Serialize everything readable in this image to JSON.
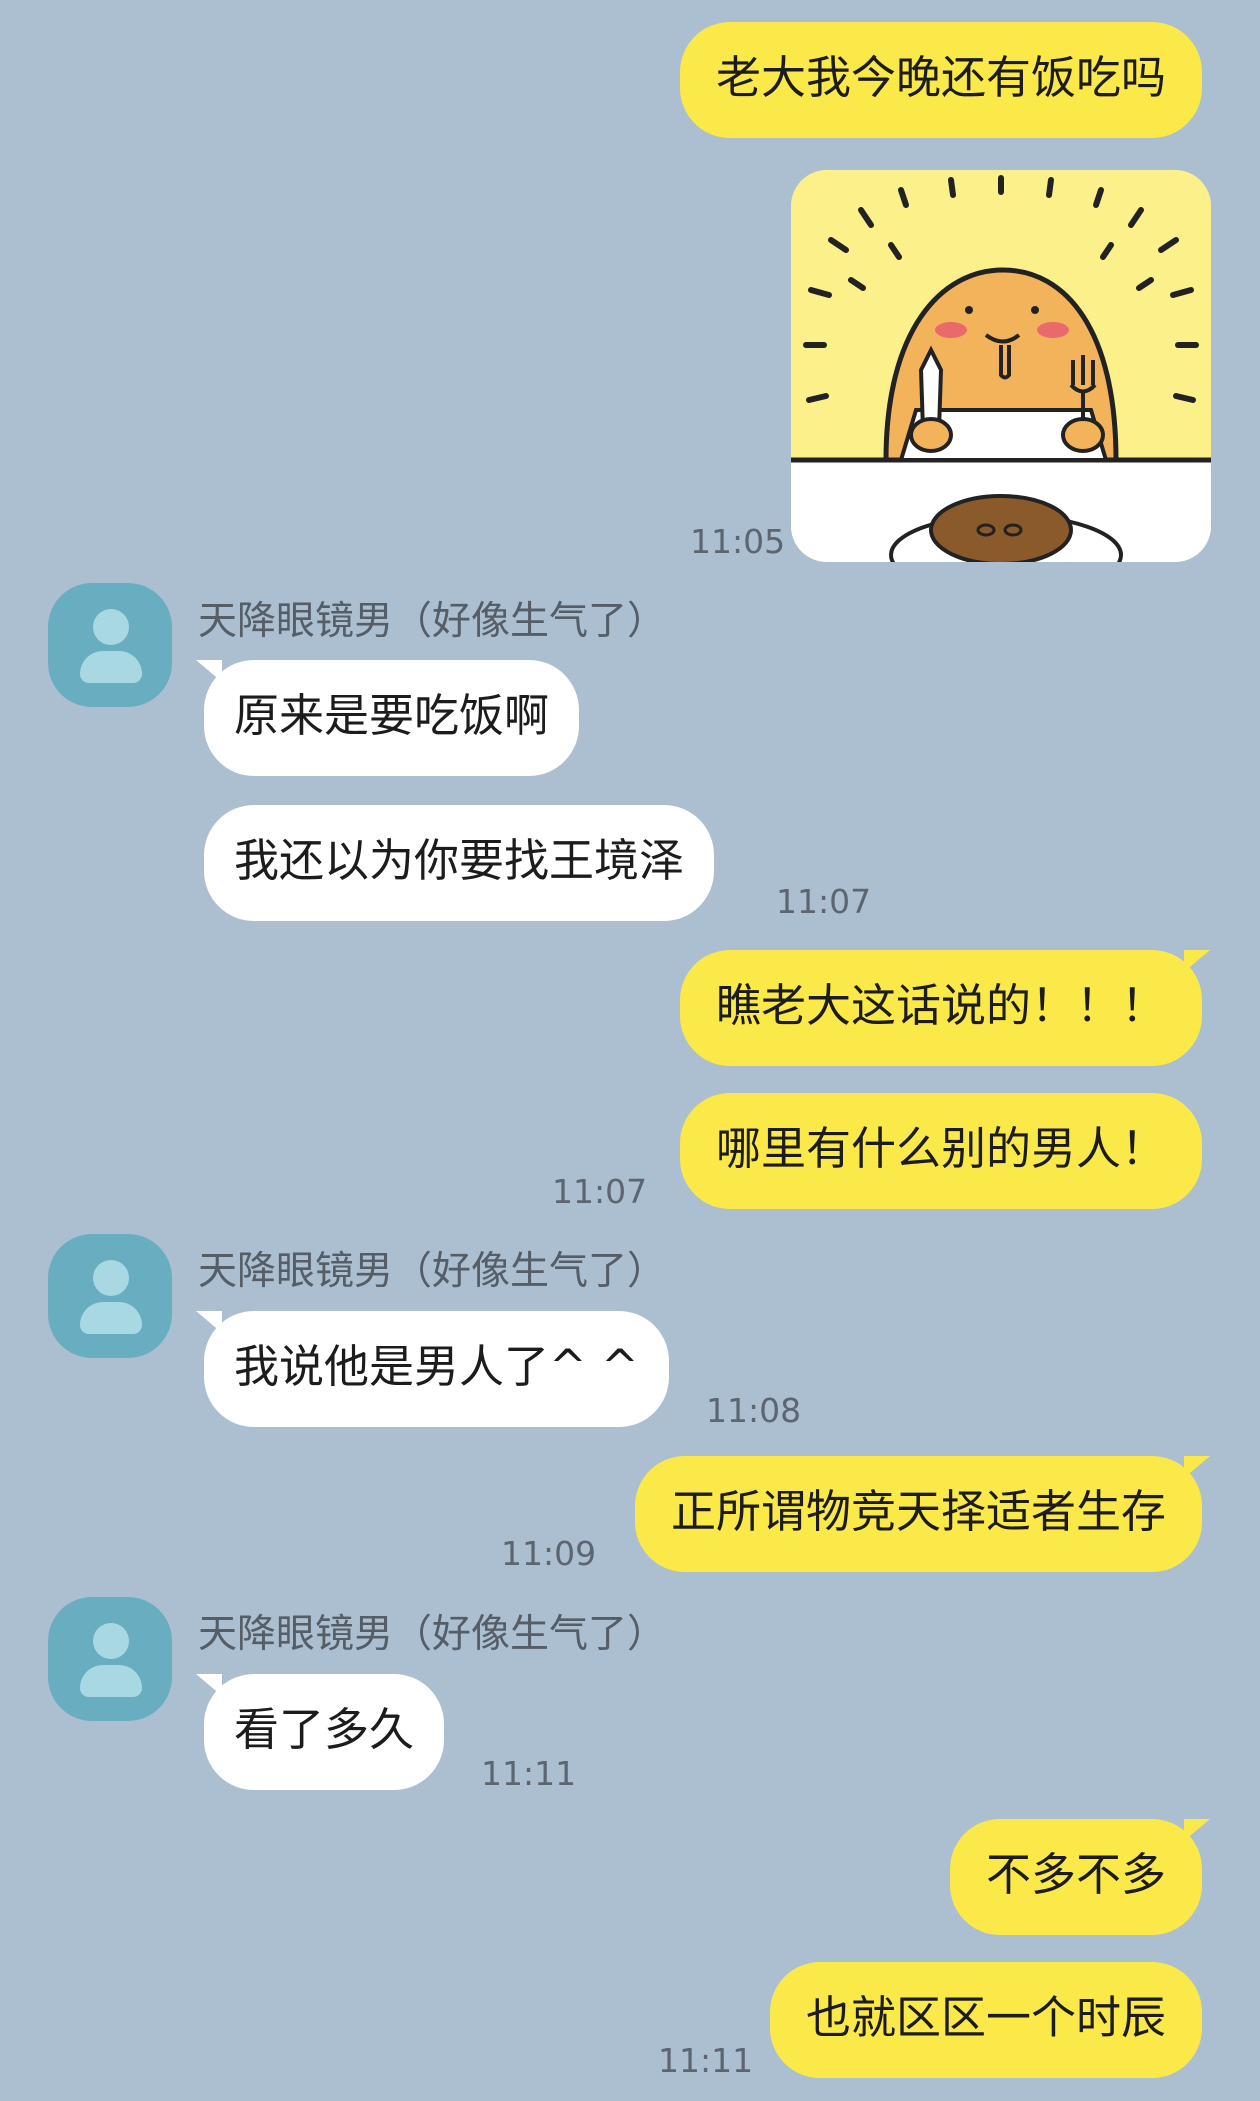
{
  "colors": {
    "background": "#acbfd0",
    "sent_bubble": "#fbe94a",
    "received_bubble": "#ffffff",
    "avatar": "#69aec0"
  },
  "contact": {
    "name": "天降眼镜男（好像生气了）",
    "avatar_icon": "user-icon"
  },
  "messages": {
    "m1": "老大我今晚还有饭吃吗",
    "m1_sticker": "sticker-eating-character",
    "m1_time": "11:05",
    "m2": "原来是要吃饭啊",
    "m3": "我还以为你要找王境泽",
    "m3_time": "11:07",
    "m4": "瞧老大这话说的！！！",
    "m5": "哪里有什么别的男人！",
    "m5_time": "11:07",
    "m6": "我说他是男人了^ ^",
    "m6_time": "11:08",
    "m7": "正所谓物竞天择适者生存",
    "m7_time": "11:09",
    "m8": "看了多久",
    "m8_time": "11:11",
    "m9": "不多不多",
    "m10": "也就区区一个时辰",
    "m10_time": "11:11"
  }
}
